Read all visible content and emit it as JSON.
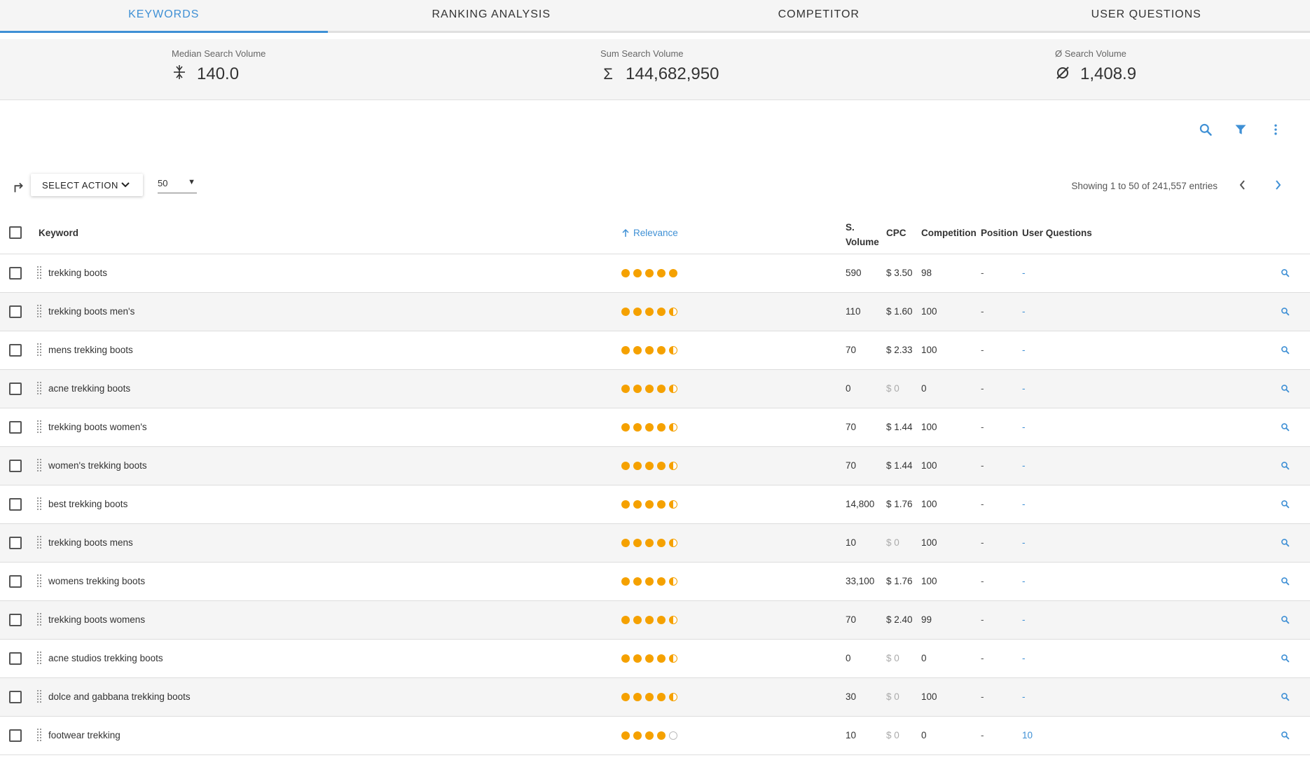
{
  "tabs": [
    {
      "label": "KEYWORDS",
      "active": true
    },
    {
      "label": "RANKING ANALYSIS",
      "active": false
    },
    {
      "label": "COMPETITOR",
      "active": false
    },
    {
      "label": "USER QUESTIONS",
      "active": false
    }
  ],
  "stats": {
    "median": {
      "label": "Median Search Volume",
      "icon": "median-icon",
      "value": "140.0"
    },
    "sum": {
      "label": "Sum Search Volume",
      "icon": "sigma-icon",
      "value": "144,682,950"
    },
    "avg": {
      "label": "Ø Search Volume",
      "icon": "average-icon",
      "value": "1,408.9"
    }
  },
  "toolbar": {
    "icons": [
      "search-icon",
      "filter-icon",
      "more-vert-icon"
    ]
  },
  "actions": {
    "select_action_label": "SELECT ACTION",
    "page_size": "50",
    "entries_text": "Showing 1 to 50 of 241,557 entries"
  },
  "colors": {
    "accent": "#3f90d5",
    "rating": "#f5a100"
  },
  "table": {
    "headers": {
      "keyword": "Keyword",
      "relevance": "Relevance",
      "svolume_1": "S.",
      "svolume_2": "Volume",
      "cpc": "CPC",
      "competition": "Competition",
      "position": "Position",
      "user_questions": "User Questions"
    },
    "rows": [
      {
        "keyword": "trekking boots",
        "rating": 5,
        "volume": "590",
        "cpc": "$ 3.50",
        "competition": "98",
        "position": "-",
        "questions": "-"
      },
      {
        "keyword": "trekking boots men's",
        "rating": 4.5,
        "volume": "110",
        "cpc": "$ 1.60",
        "competition": "100",
        "position": "-",
        "questions": "-"
      },
      {
        "keyword": "mens trekking boots",
        "rating": 4.5,
        "volume": "70",
        "cpc": "$ 2.33",
        "competition": "100",
        "position": "-",
        "questions": "-"
      },
      {
        "keyword": "acne trekking boots",
        "rating": 4.5,
        "volume": "0",
        "cpc": "$ 0",
        "competition": "0",
        "position": "-",
        "questions": "-"
      },
      {
        "keyword": "trekking boots women's",
        "rating": 4.5,
        "volume": "70",
        "cpc": "$ 1.44",
        "competition": "100",
        "position": "-",
        "questions": "-"
      },
      {
        "keyword": "women's trekking boots",
        "rating": 4.5,
        "volume": "70",
        "cpc": "$ 1.44",
        "competition": "100",
        "position": "-",
        "questions": "-"
      },
      {
        "keyword": "best trekking boots",
        "rating": 4.5,
        "volume": "14,800",
        "cpc": "$ 1.76",
        "competition": "100",
        "position": "-",
        "questions": "-"
      },
      {
        "keyword": "trekking boots mens",
        "rating": 4.5,
        "volume": "10",
        "cpc": "$ 0",
        "competition": "100",
        "position": "-",
        "questions": "-"
      },
      {
        "keyword": "womens trekking boots",
        "rating": 4.5,
        "volume": "33,100",
        "cpc": "$ 1.76",
        "competition": "100",
        "position": "-",
        "questions": "-"
      },
      {
        "keyword": "trekking boots womens",
        "rating": 4.5,
        "volume": "70",
        "cpc": "$ 2.40",
        "competition": "99",
        "position": "-",
        "questions": "-"
      },
      {
        "keyword": "acne studios trekking boots",
        "rating": 4.5,
        "volume": "0",
        "cpc": "$ 0",
        "competition": "0",
        "position": "-",
        "questions": "-"
      },
      {
        "keyword": "dolce and gabbana trekking boots",
        "rating": 4.5,
        "volume": "30",
        "cpc": "$ 0",
        "competition": "100",
        "position": "-",
        "questions": "-"
      },
      {
        "keyword": "footwear trekking",
        "rating": 4,
        "volume": "10",
        "cpc": "$ 0",
        "competition": "0",
        "position": "-",
        "questions": "10"
      }
    ]
  }
}
